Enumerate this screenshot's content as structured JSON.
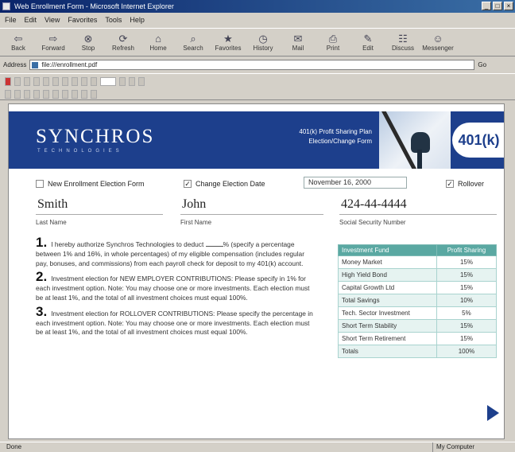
{
  "browser": {
    "title": "Web Enrollment Form - Microsoft Internet Explorer",
    "menu": [
      "File",
      "Edit",
      "View",
      "Favorites",
      "Tools",
      "Help"
    ],
    "toolbar": [
      {
        "label": "Back",
        "icon": "back-arrow-icon",
        "glyph": "⇦"
      },
      {
        "label": "Forward",
        "icon": "forward-arrow-icon",
        "glyph": "⇨"
      },
      {
        "label": "Stop",
        "icon": "stop-icon",
        "glyph": "⊗"
      },
      {
        "label": "Refresh",
        "icon": "refresh-icon",
        "glyph": "⟳"
      },
      {
        "label": "Home",
        "icon": "home-icon",
        "glyph": "⌂"
      },
      {
        "label": "Search",
        "icon": "search-icon",
        "glyph": "⌕"
      },
      {
        "label": "Favorites",
        "icon": "favorites-icon",
        "glyph": "★"
      },
      {
        "label": "History",
        "icon": "history-icon",
        "glyph": "◷"
      },
      {
        "label": "Mail",
        "icon": "mail-icon",
        "glyph": "✉"
      },
      {
        "label": "Print",
        "icon": "print-icon",
        "glyph": "⎙"
      },
      {
        "label": "Edit",
        "icon": "edit-icon",
        "glyph": "✎"
      },
      {
        "label": "Discuss",
        "icon": "discuss-icon",
        "glyph": "☷"
      },
      {
        "label": "Messenger",
        "icon": "messenger-icon",
        "glyph": "☺"
      }
    ],
    "address_label": "Address",
    "address_value": "file:///enrollment.pdf",
    "go_label": "Go",
    "status_left": "Done",
    "status_zone": "My Computer"
  },
  "form": {
    "brand": "SYNCHROS",
    "brand_sub": "TECHNOLOGIES",
    "banner_line1": "401(k) Profit Sharing Plan",
    "banner_line2": "Election/Change Form",
    "plan_name": "401(k)",
    "options": {
      "new_enrollment": "New Enrollment Election Form",
      "change_election": "Change Election Date",
      "date_value": "November 16, 2000",
      "rollover": "Rollover"
    },
    "fields": {
      "last_name": "Smith",
      "first_name": "John",
      "ssn": "424-44-4444",
      "last_name_label": "Last Name",
      "first_name_label": "First Name",
      "ssn_label": "Social Security Number"
    },
    "instructions": [
      {
        "num": "1.",
        "text_a": "I hereby authorize Synchros Technologies to deduct",
        "text_b": "% (specify a percentage between 1% and 16%, in whole percentages) of my eligible compensation (includes regular pay, bonuses, and commissions) from each payroll check for deposit to my 401(k) account."
      },
      {
        "num": "2.",
        "text": "Investment election for NEW EMPLOYER CONTRIBUTIONS: Please specify in 1% for each investment option. Note: You may choose one or more investments. Each election must be at least 1%, and the total of all investment choices must equal 100%."
      },
      {
        "num": "3.",
        "text": "Investment election for ROLLOVER CONTRIBUTIONS: Please specify the percentage in each investment option. Note: You may choose one or more investments. Each election must be at least 1%, and the total of all investment choices must equal 100%."
      }
    ],
    "table": {
      "headers": [
        "Investment Fund",
        "Profit Sharing"
      ],
      "rows": [
        [
          "Money Market",
          "15%"
        ],
        [
          "High Yield Bond",
          "15%"
        ],
        [
          "Capital Growth Ltd",
          "15%"
        ],
        [
          "Total Savings",
          "10%"
        ],
        [
          "Tech. Sector Investment",
          "5%"
        ],
        [
          "Short Term Stability",
          "15%"
        ],
        [
          "Short Term Retirement",
          "15%"
        ],
        [
          "Totals",
          "100%"
        ]
      ]
    }
  }
}
